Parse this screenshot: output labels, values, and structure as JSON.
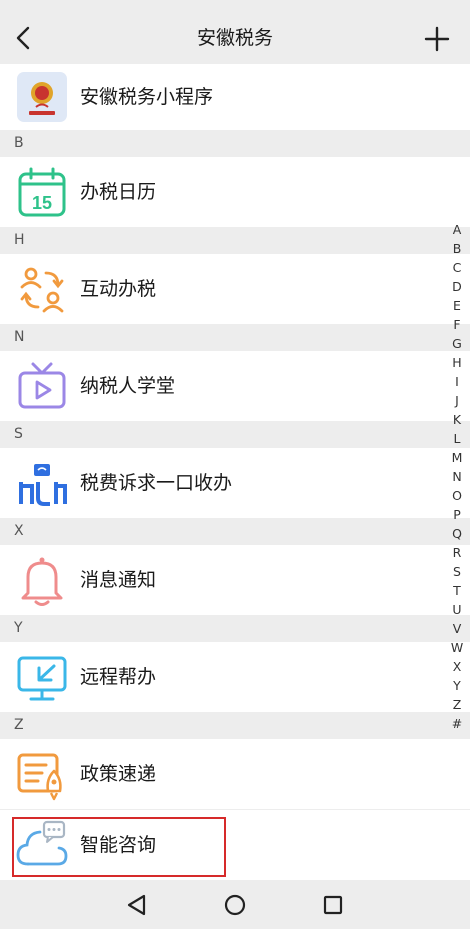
{
  "header": {
    "title": "安徽税务"
  },
  "mini_program": {
    "label": "安徽税务小程序"
  },
  "sections": [
    {
      "letter": "B",
      "label": "办税日历",
      "calendar_number": "15"
    },
    {
      "letter": "H",
      "label": "互动办税"
    },
    {
      "letter": "N",
      "label": "纳税人学堂"
    },
    {
      "letter": "S",
      "label": "税费诉求一口收办"
    },
    {
      "letter": "X",
      "label": "消息通知"
    },
    {
      "letter": "Y",
      "label": "远程帮办"
    },
    {
      "letter": "Z",
      "label": "政策速递"
    }
  ],
  "smart_consult": {
    "label": "智能咨询"
  },
  "alphabet_index": [
    "A",
    "B",
    "C",
    "D",
    "E",
    "F",
    "G",
    "H",
    "I",
    "J",
    "K",
    "L",
    "M",
    "N",
    "O",
    "P",
    "Q",
    "R",
    "S",
    "T",
    "U",
    "V",
    "W",
    "X",
    "Y",
    "Z",
    "#"
  ],
  "colors": {
    "highlight": "#d62a2a",
    "green": "#2ec28a",
    "orange": "#f19a3e",
    "purple": "#9b87e6",
    "blue": "#2f6fe0",
    "pink": "#ef8c8c",
    "cyan": "#3ab7e8"
  }
}
